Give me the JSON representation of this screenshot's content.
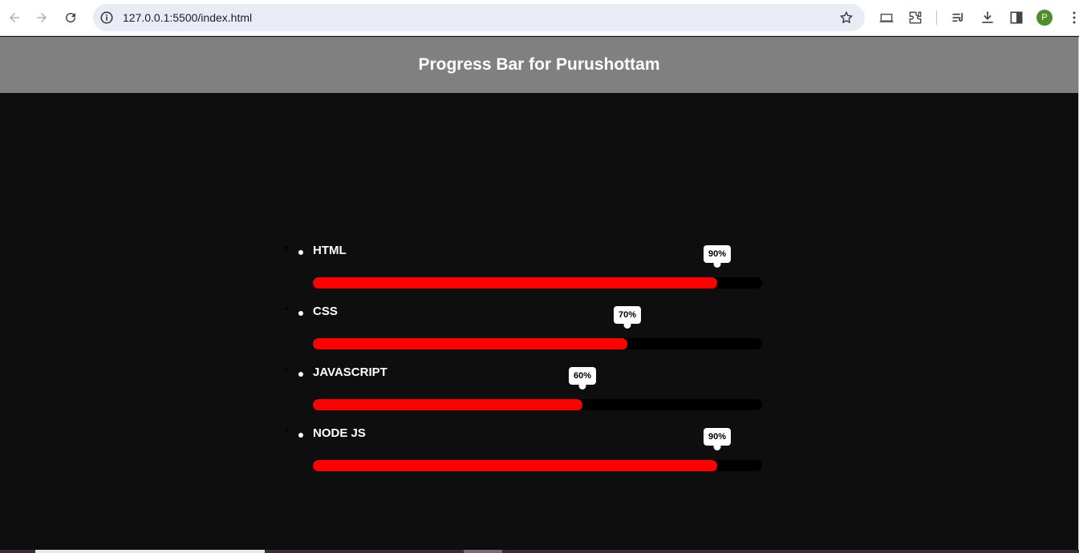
{
  "browser": {
    "url": "127.0.0.1:5500/index.html",
    "profile_initial": "P"
  },
  "page": {
    "title": "Progress Bar for Purushottam"
  },
  "skills": [
    {
      "name": "HTML",
      "percent_label": "90%",
      "percent": 90
    },
    {
      "name": "CSS",
      "percent_label": "70%",
      "percent": 70
    },
    {
      "name": "JAVASCRIPT",
      "percent_label": "60%",
      "percent": 60
    },
    {
      "name": "NODE JS",
      "percent_label": "90%",
      "percent": 90
    }
  ],
  "colors": {
    "header_bg": "#808080",
    "body_bg": "#0e0e0e",
    "fill": "#ff0000",
    "track": "#000000"
  }
}
